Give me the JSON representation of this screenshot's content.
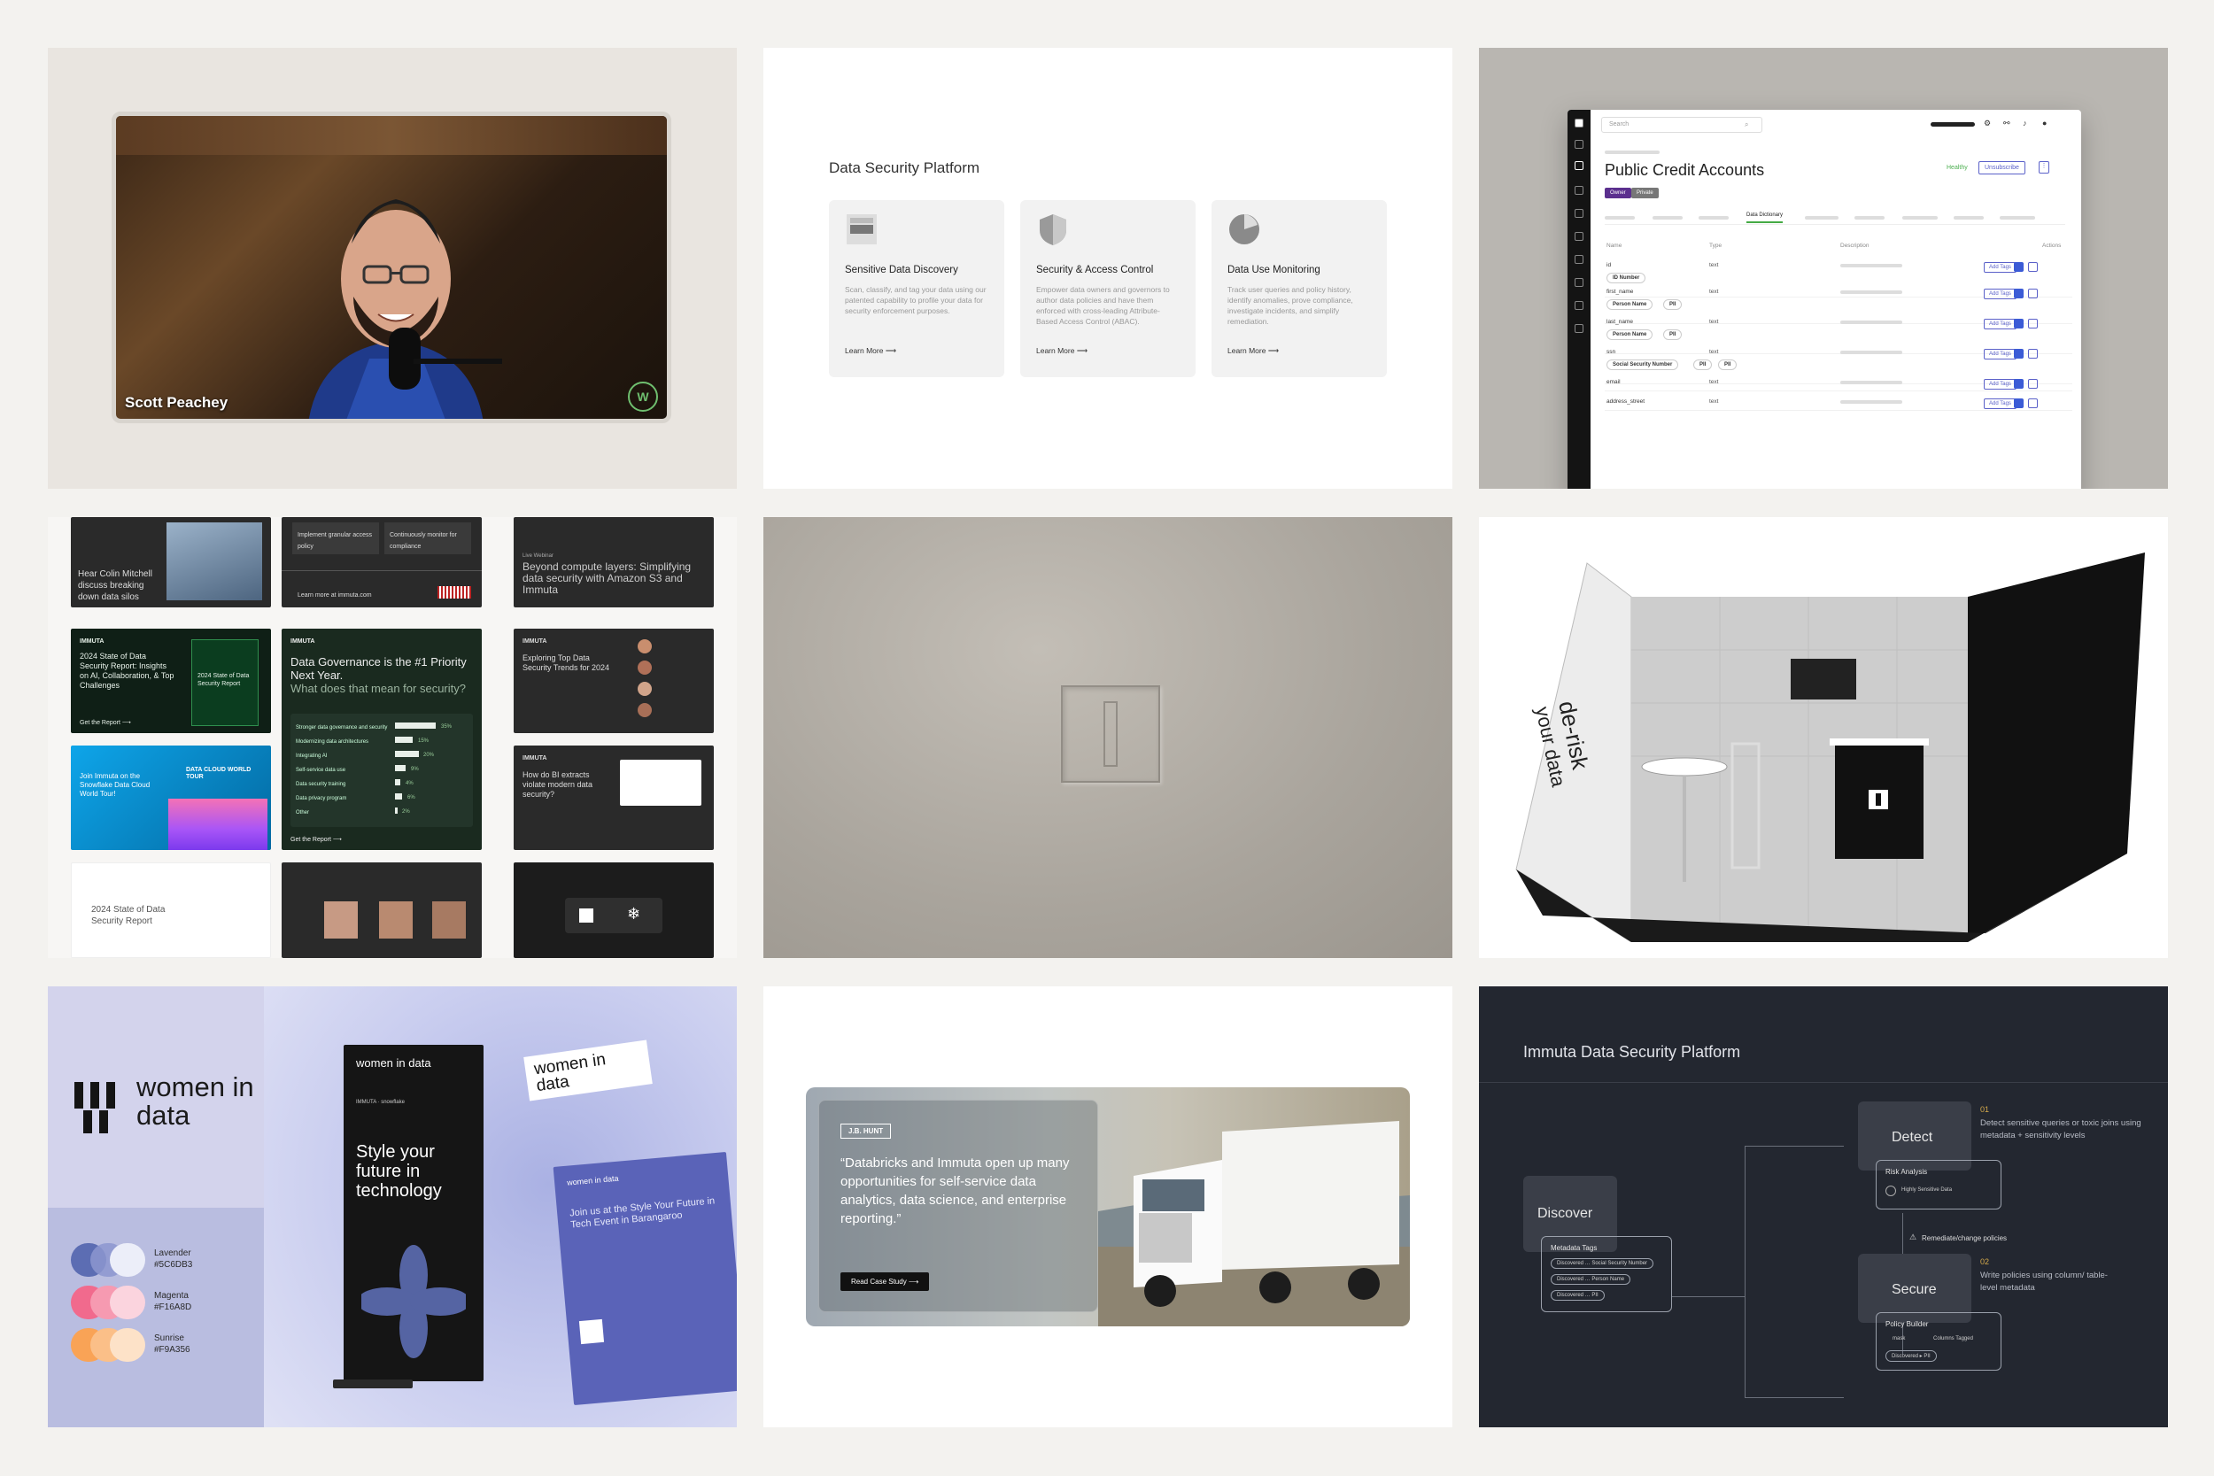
{
  "video_tile": {
    "speaker_name": "Scott Peachey"
  },
  "platform_tile": {
    "title": "Data Security Platform",
    "cards": [
      {
        "title": "Sensitive Data Discovery",
        "desc": "Scan, classify, and tag your data using our patented capability to profile your data for security enforcement purposes.",
        "link": "Learn More ⟶"
      },
      {
        "title": "Security & Access Control",
        "desc": "Empower data owners and governors to author data policies and have them enforced with cross-leading Attribute-Based Access Control (ABAC).",
        "link": "Learn More ⟶"
      },
      {
        "title": "Data Use Monitoring",
        "desc": "Track user queries and policy history, identify anomalies, prove compliance, investigate incidents, and simplify remediation.",
        "link": "Learn More ⟶"
      }
    ]
  },
  "app_tile": {
    "search_placeholder": "Search",
    "page_title": "Public Credit Accounts",
    "pills": [
      "Owner",
      "Private"
    ],
    "status": "Healthy",
    "unsubscribe": "Unsubscribe",
    "active_tab": "Data Dictionary",
    "columns": [
      "Name",
      "Type",
      "Description",
      "Actions"
    ],
    "rows": [
      {
        "name": "id",
        "type": "text",
        "tags": [
          "ID Number"
        ]
      },
      {
        "name": "first_name",
        "type": "text",
        "tags": [
          "Person Name",
          "PII"
        ]
      },
      {
        "name": "last_name",
        "type": "text",
        "tags": [
          "Person Name",
          "PII"
        ]
      },
      {
        "name": "ssn",
        "type": "text",
        "tags": [
          "Social Security Number",
          "PII",
          "PII"
        ]
      },
      {
        "name": "email",
        "type": "text",
        "tags": []
      },
      {
        "name": "address_street",
        "type": "text",
        "tags": []
      }
    ],
    "add_tags": "Add Tags"
  },
  "collage_tile": {
    "c1": "Hear Colin Mitchell discuss breaking down data silos",
    "c2a": "Implement granular access policy",
    "c2b": "Continuously monitor for compliance",
    "c2c": "Learn more at immuta.com",
    "c3a": "Live Webinar",
    "c3b": "Beyond compute layers: Simplifying data security with Amazon S3 and Immuta",
    "c4brand": "IMMUTA",
    "c4": "2024 State of Data Security Report: Insights on AI, Collaboration, & Top Challenges",
    "c4cta": "Get the Report ⟶",
    "c4book": "2024 State of Data Security Report",
    "c5": "Data Governance is the #1 Priority Next Year.",
    "c5b": "What does that mean for security?",
    "c5bars": [
      "Stronger data governance and security",
      "Modernizing data architectures",
      "Integrating AI",
      "Self-service data use",
      "Data security training",
      "Data privacy program",
      "Other"
    ],
    "c5pcts": [
      "35%",
      "15%",
      "20%",
      "9%",
      "4%",
      "6%",
      "2%"
    ],
    "c5cta": "Get the Report ⟶",
    "c6": "Exploring Top Data Security Trends for 2024",
    "c7": "Join Immuta on the Snowflake Data Cloud World Tour!",
    "c7b": "DATA CLOUD WORLD TOUR",
    "c8": "How do BI extracts violate modern data security?",
    "c9": "2024 State of Data Security Report"
  },
  "wid_tile": {
    "brand": "women in data",
    "swatches": [
      {
        "name": "Lavender",
        "hex": "#5C6DB3"
      },
      {
        "name": "Magenta",
        "hex": "#F16A8D"
      },
      {
        "name": "Sunrise",
        "hex": "#F9A356"
      }
    ],
    "banner_brand": "women in data",
    "banner_partners": "IMMUTA  ·  snowflake",
    "banner_text": "Style your future in technology",
    "sticker": "women in data",
    "poster_brand": "women in data",
    "poster_text": "Join us at the Style Your Future in Tech Event in Barangaroo"
  },
  "case_tile": {
    "logo": "J.B. HUNT",
    "quote": "“Databricks and Immuta open up many opportunities for self-service data analytics, data science, and enterprise reporting.”",
    "cta": "Read Case Study  ⟶"
  },
  "diagram_tile": {
    "title": "Immuta Data Security Platform",
    "discover": "Discover",
    "metadata_tags": "Metadata Tags",
    "meta_chips": [
      "Discovered … Social Security Number",
      "Discovered … Person Name",
      "Discovered … PII"
    ],
    "detect": "Detect",
    "risk_analysis": "Risk Analysis",
    "risk_item": "Highly Sensitive Data",
    "n1": "01",
    "n1_text": "Detect sensitive queries or toxic joins using metadata + sensitivity levels",
    "remediate": "Remediate/change policies",
    "secure": "Secure",
    "policy_builder": "Policy Builder",
    "pb_mask": "mask",
    "pb_cols": "Columns Tagged",
    "pb_chip": "Discovered ▸ PII",
    "n2": "02",
    "n2_text": "Write policies using column/ table-level metadata"
  },
  "colors": {
    "page_bg": "#f3f2ef",
    "immuta_green": "#2f8f4e",
    "wid_lavender": "#5C6DB3",
    "wid_magenta": "#F16A8D",
    "wid_sunrise": "#F9A356",
    "dark_tile": "#232730"
  }
}
